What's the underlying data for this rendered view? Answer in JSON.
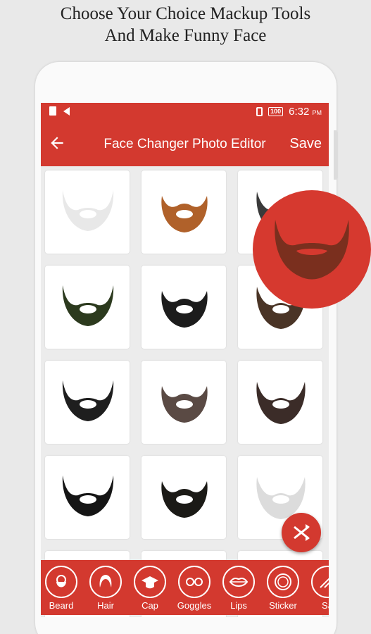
{
  "promo": {
    "line1": "Choose Your Choice Mackup Tools",
    "line2": "And Make Funny Face"
  },
  "statusbar": {
    "battery": "100",
    "time": "6:32",
    "ampm": "PM",
    "icons": [
      "sim-icon",
      "play-icon",
      "vibrate-icon",
      "battery-icon"
    ]
  },
  "appbar": {
    "back_icon": "arrow-left-icon",
    "title": "Face Changer Photo Editor",
    "save_label": "Save"
  },
  "grid": {
    "items": [
      {
        "name": "beard-1",
        "color": "#e8e8e8"
      },
      {
        "name": "beard-2",
        "color": "#b0612a"
      },
      {
        "name": "beard-3",
        "color": "#3a3a3a"
      },
      {
        "name": "beard-4",
        "color": "#2c3a1e"
      },
      {
        "name": "beard-5",
        "color": "#1c1c1c"
      },
      {
        "name": "beard-6",
        "color": "#4a3426"
      },
      {
        "name": "beard-7",
        "color": "#1e1e1e"
      },
      {
        "name": "beard-8",
        "color": "#5a4a44"
      },
      {
        "name": "beard-9",
        "color": "#3b2c28"
      },
      {
        "name": "beard-10",
        "color": "#151515"
      },
      {
        "name": "beard-11",
        "color": "#1b1a16"
      },
      {
        "name": "beard-12",
        "color": "#dcdcdc"
      }
    ]
  },
  "preview": {
    "color": "#7a2f1e",
    "bg": "#d6392f"
  },
  "fab": {
    "icon": "shuffle-icon"
  },
  "tools": [
    {
      "label": "Beard",
      "icon": "beard-face-icon"
    },
    {
      "label": "Hair",
      "icon": "hair-icon"
    },
    {
      "label": "Cap",
      "icon": "cap-icon"
    },
    {
      "label": "Goggles",
      "icon": "goggles-icon"
    },
    {
      "label": "Lips",
      "icon": "lips-icon"
    },
    {
      "label": "Sticker",
      "icon": "sticker-icon"
    },
    {
      "label": "Sa",
      "icon": "more-icon"
    }
  ],
  "colors": {
    "accent": "#d3392f"
  }
}
